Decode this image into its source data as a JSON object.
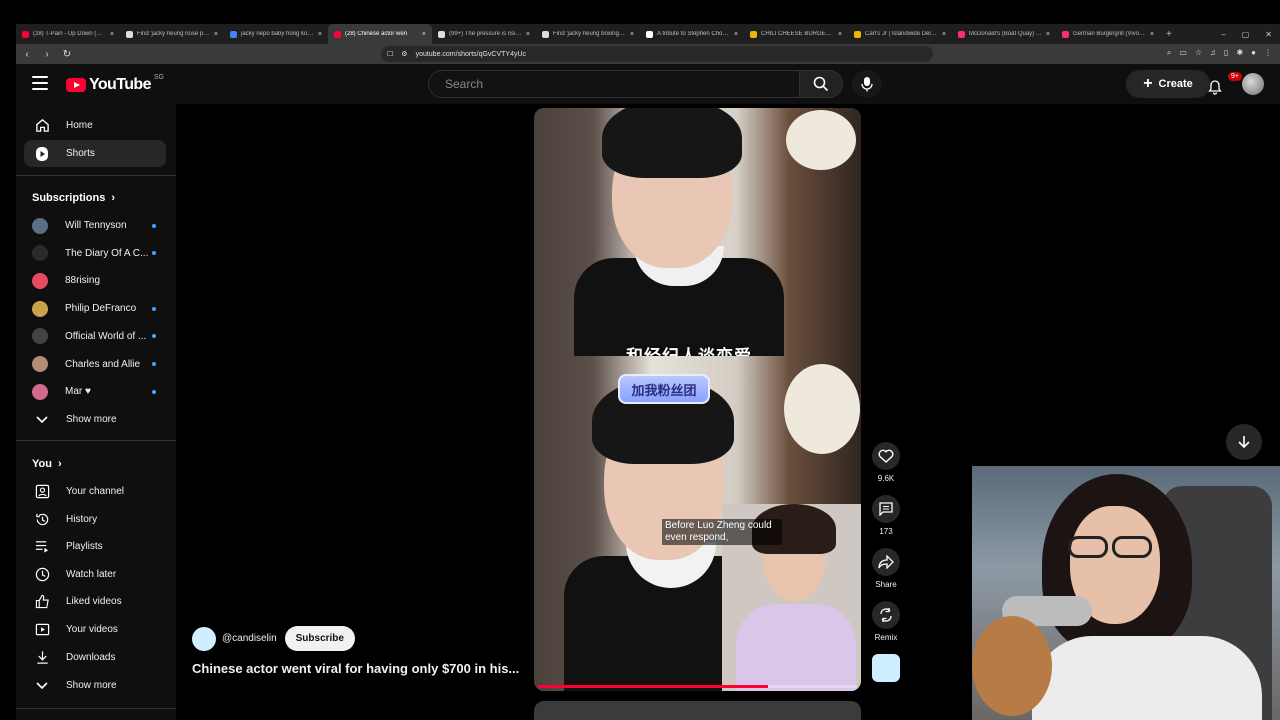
{
  "browser": {
    "tabs": [
      {
        "label": "(28) T-Pain - Up Down (Do Th",
        "color": "#ff0033",
        "active": false
      },
      {
        "label": "Find 'jacky heung nose pose",
        "color": "#dddddd",
        "active": false
      },
      {
        "label": "jacky nepo baby hong kong",
        "color": "#4285f4",
        "active": false
      },
      {
        "label": "(28) Chinese actor wen",
        "color": "#ff0033",
        "active": true
      },
      {
        "label": "(99+) The pressure is rising on",
        "color": "#dddddd",
        "active": false
      },
      {
        "label": "Find 'jacky heung boxing' on",
        "color": "#dddddd",
        "active": false
      },
      {
        "label": "A tribute to Stephen Chow?",
        "color": "#ffffff",
        "active": false
      },
      {
        "label": "CHILI CHEESE BURGER - Carl'",
        "color": "#f0b400",
        "active": false
      },
      {
        "label": "Carl's Jr | Islandwide Delivery",
        "color": "#f0b400",
        "active": false
      },
      {
        "label": "McDonald's (Boat Quay) Men",
        "color": "#ff2d6f",
        "active": false
      },
      {
        "label": "German Burgergrill (VivoCity)",
        "color": "#ff2d6f",
        "active": false
      }
    ],
    "url": "youtube.com/shorts/qGvCVTY4yUc"
  },
  "header": {
    "logo_text": "YouTube",
    "country_code": "SG",
    "search_placeholder": "Search",
    "create_label": "Create",
    "notification_count": "9+"
  },
  "sidebar": {
    "main": [
      {
        "label": "Home",
        "icon": "home-icon"
      },
      {
        "label": "Shorts",
        "icon": "shorts-icon"
      }
    ],
    "subscriptions_title": "Subscriptions",
    "subscriptions": [
      {
        "label": "Will Tennyson",
        "color": "#5a6e86"
      },
      {
        "label": "The Diary Of A C...",
        "color": "#2a2a2a"
      },
      {
        "label": "88rising",
        "color": "#e84a5f"
      },
      {
        "label": "Philip DeFranco",
        "color": "#c9a24a"
      },
      {
        "label": "Official World of ...",
        "color": "#444444"
      },
      {
        "label": "Charles and Allie",
        "color": "#b08b76"
      },
      {
        "label": "Mar ♥",
        "color": "#d06b8f"
      }
    ],
    "show_more": "Show more",
    "you_title": "You",
    "you_items": [
      {
        "label": "Your channel",
        "icon": "channel-icon"
      },
      {
        "label": "History",
        "icon": "history-icon"
      },
      {
        "label": "Playlists",
        "icon": "playlists-icon"
      },
      {
        "label": "Watch later",
        "icon": "watch-later-icon"
      },
      {
        "label": "Liked videos",
        "icon": "like-icon"
      },
      {
        "label": "Your videos",
        "icon": "your-videos-icon"
      },
      {
        "label": "Downloads",
        "icon": "download-icon"
      }
    ],
    "show_more_2": "Show more"
  },
  "short": {
    "caption_cn": "和经纪人谈恋爱",
    "sticker_cn": "加我粉丝团",
    "subtitle": "Before Luo Zheng could even respond,",
    "progress": 0.72,
    "likes": "9.6K",
    "comments": "173",
    "share_label": "Share",
    "remix_label": "Remix",
    "channel_handle": "@candiselin",
    "subscribe_label": "Subscribe",
    "title": "Chinese actor went viral for having only $700 in his..."
  }
}
